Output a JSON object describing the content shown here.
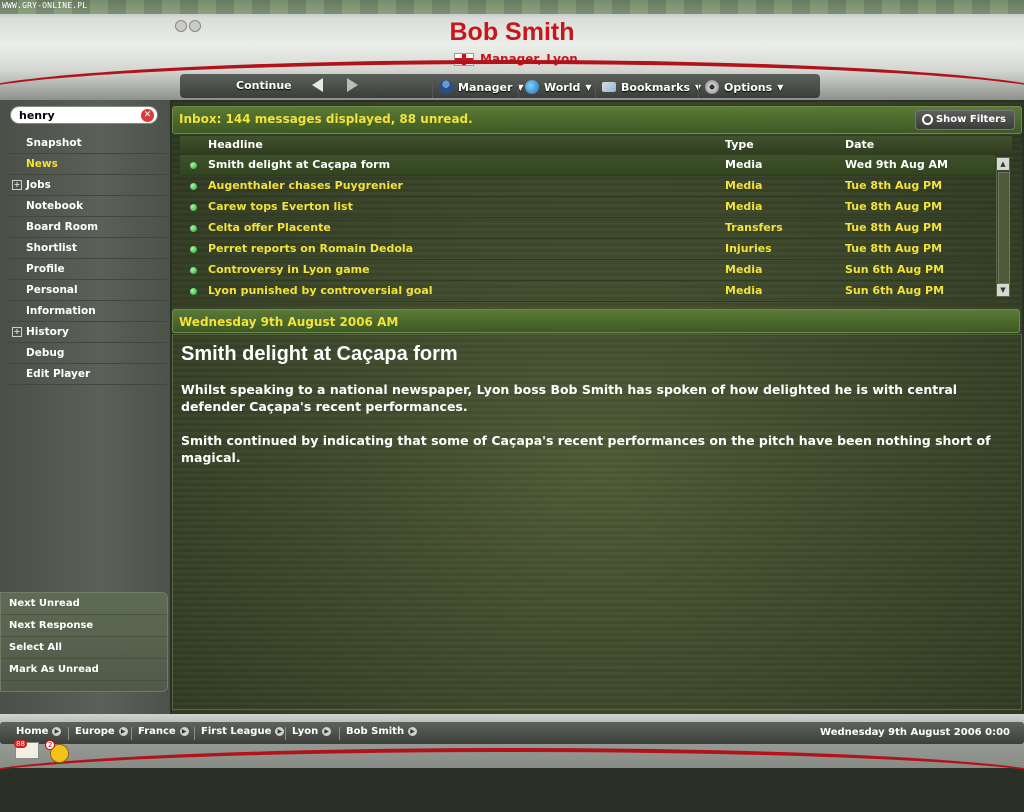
{
  "watermark": "WWW.GRY-ONLINE.PL",
  "header": {
    "manager_name": "Bob Smith",
    "role": "Manager, Lyon",
    "continue_label": "Continue",
    "menus": [
      {
        "label": "Manager",
        "icon": "manager-icon"
      },
      {
        "label": "World",
        "icon": "globe-icon"
      },
      {
        "label": "Bookmarks",
        "icon": "bookmark-icon"
      },
      {
        "label": "Options",
        "icon": "gear-icon"
      }
    ]
  },
  "sidebar": {
    "search_value": "henry",
    "items": [
      {
        "label": "Snapshot"
      },
      {
        "label": "News"
      },
      {
        "label": "Jobs"
      },
      {
        "label": "Notebook"
      },
      {
        "label": "Board Room"
      },
      {
        "label": "Shortlist"
      },
      {
        "label": "Profile"
      },
      {
        "label": "Personal"
      },
      {
        "label": "Information"
      },
      {
        "label": "History"
      },
      {
        "label": "Debug"
      },
      {
        "label": "Edit Player"
      }
    ],
    "actions": [
      {
        "label": "Next Unread"
      },
      {
        "label": "Next Response"
      },
      {
        "label": "Select All"
      },
      {
        "label": "Mark As Unread"
      }
    ]
  },
  "inbox": {
    "title": "Inbox: 144 messages displayed, 88 unread.",
    "show_filters": "Show Filters",
    "columns": {
      "headline": "Headline",
      "type": "Type",
      "date": "Date"
    },
    "rows": [
      {
        "headline": "Smith delight at Caçapa form",
        "type": "Media",
        "date": "Wed 9th Aug AM"
      },
      {
        "headline": "Augenthaler chases Puygrenier",
        "type": "Media",
        "date": "Tue 8th Aug PM"
      },
      {
        "headline": "Carew tops Everton list",
        "type": "Media",
        "date": "Tue 8th Aug PM"
      },
      {
        "headline": "Celta offer Placente",
        "type": "Transfers",
        "date": "Tue 8th Aug PM"
      },
      {
        "headline": "Perret reports on Romain Dedola",
        "type": "Injuries",
        "date": "Tue 8th Aug PM"
      },
      {
        "headline": "Controversy in Lyon game",
        "type": "Media",
        "date": "Sun 6th Aug PM"
      },
      {
        "headline": "Lyon punished by controversial goal",
        "type": "Media",
        "date": "Sun 6th Aug PM"
      }
    ]
  },
  "message": {
    "date": "Wednesday 9th August 2006 AM",
    "headline": "Smith delight at Caçapa form",
    "paragraph1": "Whilst speaking to a national newspaper, Lyon boss Bob Smith has spoken of how delighted he is with central defender Caçapa's recent performances.",
    "paragraph2": "Smith continued by indicating that some of Caçapa's recent performances on the pitch have been nothing short of magical."
  },
  "footer": {
    "breadcrumbs": [
      {
        "label": "Home"
      },
      {
        "label": "Europe"
      },
      {
        "label": "France"
      },
      {
        "label": "First League"
      },
      {
        "label": "Lyon"
      },
      {
        "label": "Bob Smith"
      }
    ],
    "datetime": "Wednesday 9th August 2006 0:00",
    "mail_count": "88",
    "reminder_count": "2"
  }
}
